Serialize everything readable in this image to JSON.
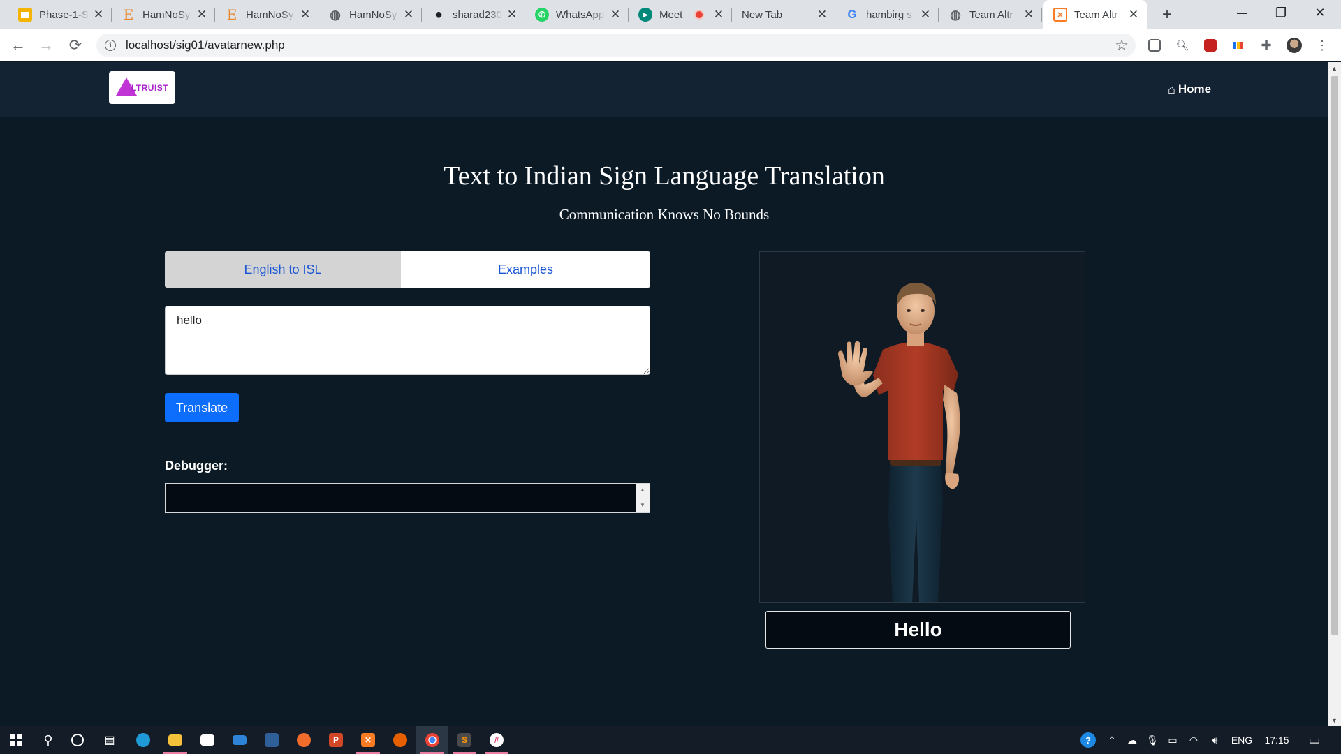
{
  "browser": {
    "tabs": [
      {
        "title": "Phase-1-S",
        "icon": "slides-icon",
        "color": "#f4b400",
        "glyph": ""
      },
      {
        "title": "HamNoSy",
        "icon": "e-letter-icon",
        "color": "#e8862a",
        "glyph": "E"
      },
      {
        "title": "HamNoSy",
        "icon": "e-letter-icon",
        "color": "#e8862a",
        "glyph": "E"
      },
      {
        "title": "HamNoSy",
        "icon": "globe-icon",
        "color": "#5f6368",
        "glyph": "◍"
      },
      {
        "title": "sharad230",
        "icon": "github-icon",
        "color": "#202124",
        "glyph": "●"
      },
      {
        "title": "WhatsApp",
        "icon": "whatsapp-icon",
        "color": "#25d366",
        "glyph": "✆"
      },
      {
        "title": "Meet",
        "icon": "meet-icon",
        "color": "#00897b",
        "glyph": "▶"
      },
      {
        "title": "New Tab",
        "icon": "",
        "color": "",
        "glyph": ""
      },
      {
        "title": "hambirg s",
        "icon": "google-icon",
        "color": "#4285f4",
        "glyph": "G"
      },
      {
        "title": "Team Altr",
        "icon": "globe-icon",
        "color": "#5f6368",
        "glyph": "◍"
      },
      {
        "title": "Team Altr",
        "icon": "xampp-icon",
        "color": "#fb7a24",
        "glyph": "✕"
      }
    ],
    "new_tab_symbol": "+",
    "window": {
      "minimize": "—",
      "maximize": "❐",
      "close": "✕"
    },
    "nav": {
      "back": "←",
      "forward": "→",
      "reload": "⟳"
    },
    "url": "localhost/sig01/avatarnew.php",
    "info_symbol": "i",
    "star_symbol": "☆"
  },
  "site": {
    "logo_text": "LTRUIST",
    "home_label": "Home",
    "home_icon_glyph": "⌂",
    "title": "Text to Indian Sign Language Translation",
    "subtitle": "Communication Knows No Bounds",
    "tabs": [
      "English to ISL",
      "Examples"
    ],
    "input_value": "hello",
    "translate_label": "Translate",
    "debugger_label": "Debugger:",
    "debugger_value": "",
    "output_word": "Hello",
    "colors": {
      "page_bg": "#0c1a26",
      "navbar_bg": "#142333",
      "accent": "#0d6efd",
      "tab_text": "#1a56d6",
      "logo": "#c034d6"
    }
  },
  "taskbar": {
    "language": "ENG",
    "time": "17:15"
  }
}
